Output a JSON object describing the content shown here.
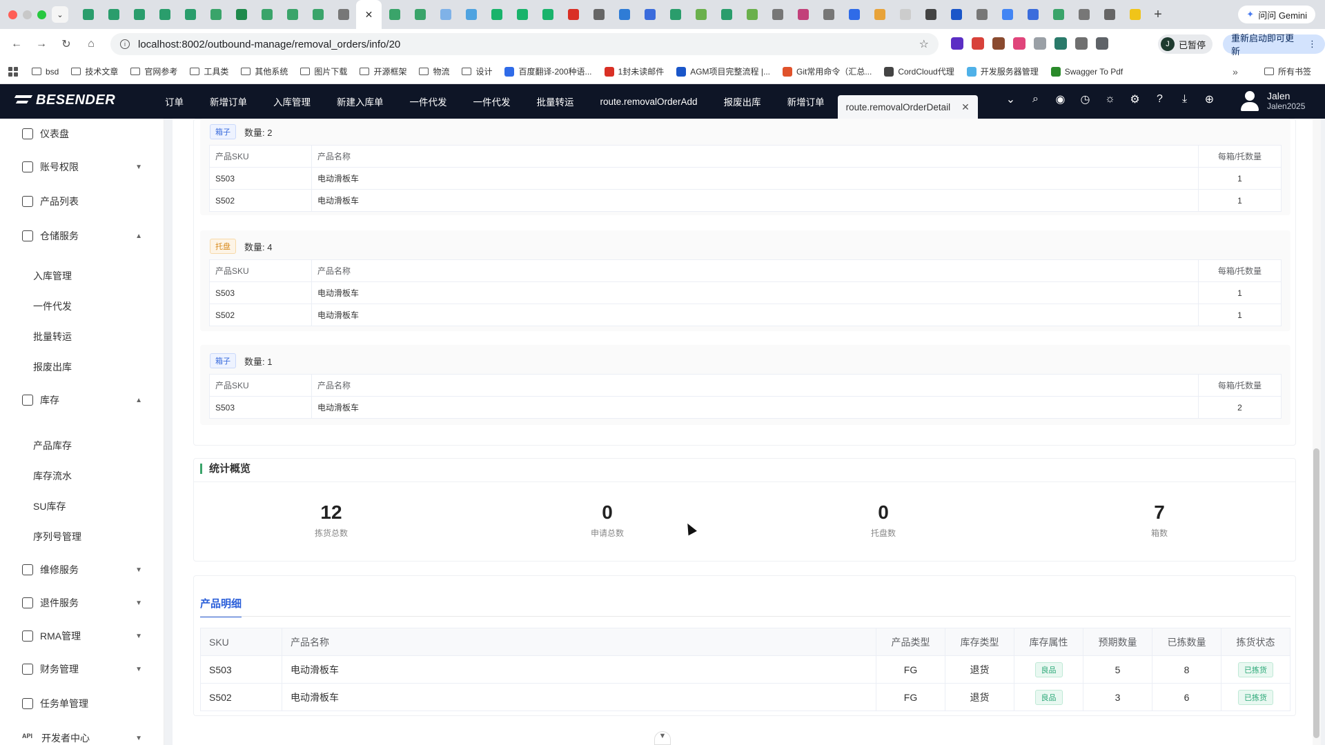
{
  "browser": {
    "gemini_label": "问问 Gemini",
    "url": "localhost:8002/outbound-manage/removal_orders/info/20",
    "paused_label": "已暂停",
    "profile_initial": "J",
    "relaunch_label": "重新启动即可更新",
    "bookmarks": [
      {
        "label": "bsd",
        "icon": "folder"
      },
      {
        "label": "技术文章",
        "icon": "folder"
      },
      {
        "label": "官网参考",
        "icon": "folder"
      },
      {
        "label": "工具类",
        "icon": "folder"
      },
      {
        "label": "其他系统",
        "icon": "folder"
      },
      {
        "label": "图片下载",
        "icon": "folder"
      },
      {
        "label": "开源框架",
        "icon": "folder"
      },
      {
        "label": "物流",
        "icon": "folder"
      },
      {
        "label": "设计",
        "icon": "folder"
      },
      {
        "label": "百度翻译-200种语...",
        "icon": "favicon",
        "color": "#2f6be8"
      },
      {
        "label": "1封未读邮件",
        "icon": "favicon",
        "color": "#d93025"
      },
      {
        "label": "AGM项目完整流程 |...",
        "icon": "favicon",
        "color": "#1a56c9"
      },
      {
        "label": "Git常用命令（汇总...",
        "icon": "favicon",
        "color": "#e0522b"
      },
      {
        "label": "CordCloud代理",
        "icon": "favicon",
        "color": "#444444"
      },
      {
        "label": "开发服务器管理",
        "icon": "favicon",
        "color": "#4fb1e8"
      },
      {
        "label": "Swagger To Pdf",
        "icon": "favicon",
        "color": "#2a8a2a"
      }
    ],
    "bookmarks_all": "所有书签"
  },
  "header": {
    "brand": "BESENDER",
    "tabs": [
      "订单",
      "新增订单",
      "入库管理",
      "新建入库单",
      "一件代发",
      "一件代发",
      "批量转运",
      "route.removalOrderAdd",
      "报废出库",
      "新增订单"
    ],
    "active_tab": "route.removalOrderDetail",
    "user_name": "Jalen",
    "user_id": "Jalen2025"
  },
  "sidebar": {
    "items": [
      {
        "label": "仪表盘",
        "top": 0
      },
      {
        "label": "账号权限",
        "arrow": "down"
      },
      {
        "label": "产品列表"
      },
      {
        "label": "仓储服务",
        "arrow": "up"
      }
    ],
    "storage_subs": [
      "入库管理",
      "一件代发",
      "批量转运",
      "报废出库"
    ],
    "inventory": "库存",
    "inventory_subs": [
      "产品库存",
      "库存流水",
      "SU库存",
      "序列号管理"
    ],
    "bottom_items": [
      "维修服务",
      "退件服务",
      "RMA管理",
      "财务管理",
      "任务单管理",
      "开发者中心"
    ],
    "api_glyph": "API"
  },
  "packages": [
    {
      "type_label": "箱子",
      "kind": "box",
      "qty_label": "数量: 2",
      "headers": [
        "产品SKU",
        "产品名称",
        "每箱/托数量"
      ],
      "rows": [
        [
          "S503",
          "电动滑板车",
          "1"
        ],
        [
          "S502",
          "电动滑板车",
          "1"
        ]
      ]
    },
    {
      "type_label": "托盘",
      "kind": "pallet",
      "qty_label": "数量: 4",
      "headers": [
        "产品SKU",
        "产品名称",
        "每箱/托数量"
      ],
      "rows": [
        [
          "S503",
          "电动滑板车",
          "1"
        ],
        [
          "S502",
          "电动滑板车",
          "1"
        ]
      ]
    },
    {
      "type_label": "箱子",
      "kind": "box",
      "qty_label": "数量: 1",
      "headers": [
        "产品SKU",
        "产品名称",
        "每箱/托数量"
      ],
      "rows": [
        [
          "S503",
          "电动滑板车",
          "2"
        ]
      ]
    }
  ],
  "stats": {
    "title": "统计概览",
    "items": [
      {
        "value": "12",
        "label": "拣货总数"
      },
      {
        "value": "0",
        "label": "申请总数"
      },
      {
        "value": "0",
        "label": "托盘数"
      },
      {
        "value": "7",
        "label": "箱数"
      }
    ]
  },
  "detail": {
    "tab_label": "产品明细",
    "headers": [
      "SKU",
      "产品名称",
      "产品类型",
      "库存类型",
      "库存属性",
      "预期数量",
      "已拣数量",
      "拣货状态"
    ],
    "rows": [
      [
        "S503",
        "电动滑板车",
        "FG",
        "退货",
        "良品",
        "5",
        "8",
        "已拣货"
      ],
      [
        "S502",
        "电动滑板车",
        "FG",
        "退货",
        "良品",
        "3",
        "6",
        "已拣货"
      ]
    ]
  }
}
